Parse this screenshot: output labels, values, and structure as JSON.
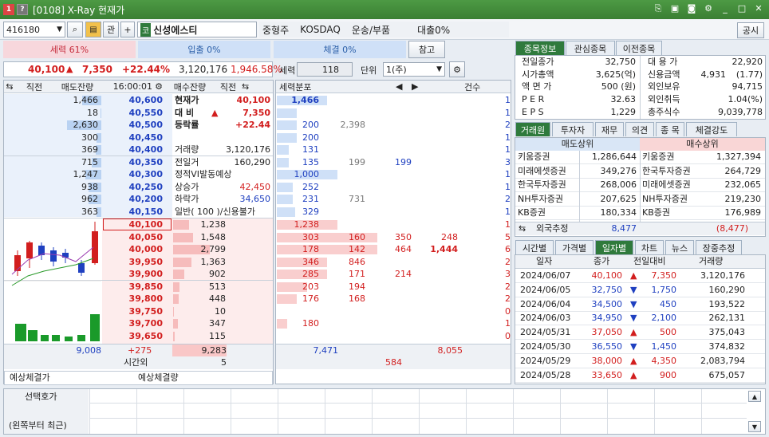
{
  "window": {
    "title": "[0108] X-Ray 현재가"
  },
  "toolbar": {
    "code": "416180",
    "gwan": "관",
    "market_badge": "코",
    "stock_name": "신성에스티",
    "size": "중형주",
    "market": "KOSDAQ",
    "sector": "운송/부품",
    "loan": "대출0%",
    "notice": "공시"
  },
  "indicators": {
    "force": "세력 61%",
    "inflow": "입출 0%",
    "contract": "체결 0%",
    "ref": "참고"
  },
  "quote": {
    "price": "40,100",
    "change": "7,350",
    "rate": "+22.44%",
    "volume": "3,120,176",
    "amount": "1,946.58%"
  },
  "controls": {
    "force_label": "세력",
    "force_val": "118",
    "unit_label": "단위",
    "unit_val": "1(주)"
  },
  "ob_header": {
    "c1": "직전",
    "c2": "매도잔량",
    "time": "16:00:01",
    "c3": "매수잔량",
    "c4": "직전",
    "dist": "세력분포",
    "cnt": "건수"
  },
  "asks": [
    {
      "qty": "1,466",
      "price": "40,600",
      "bar": 0.2,
      "d1": "1,466",
      "d2": "",
      "d3": "",
      "cnt": "1",
      "dbar": 0.5
    },
    {
      "qty": "18",
      "price": "40,550",
      "bar": 0.01,
      "d1": "",
      "d2": "",
      "d3": "",
      "cnt": "1",
      "dbar": 0.2
    },
    {
      "qty": "2,630",
      "price": "40,500",
      "bar": 0.36,
      "d1": "200",
      "d2": "2,398",
      "d3": "",
      "cnt": "2",
      "dbar": 0.2
    },
    {
      "qty": "300",
      "price": "40,450",
      "bar": 0.05,
      "d1": "200",
      "d2": "",
      "d3": "",
      "cnt": "1",
      "dbar": 0.2
    },
    {
      "qty": "369",
      "price": "40,400",
      "bar": 0.06,
      "d1": "131",
      "d2": "",
      "d3": "",
      "cnt": "1",
      "dbar": 0.12
    },
    {
      "qty": "715",
      "price": "40,350",
      "bar": 0.1,
      "d1": "135",
      "d2": "199",
      "d3": "199",
      "cnt": "3",
      "dbar": 0.12
    },
    {
      "qty": "1,247",
      "price": "40,300",
      "bar": 0.17,
      "d1": "1,000",
      "d2": "",
      "d3": "",
      "cnt": "1",
      "dbar": 0.6
    },
    {
      "qty": "938",
      "price": "40,250",
      "bar": 0.13,
      "d1": "252",
      "d2": "",
      "d3": "",
      "cnt": "1",
      "dbar": 0.16
    },
    {
      "qty": "962",
      "price": "40,200",
      "bar": 0.13,
      "d1": "231",
      "d2": "731",
      "d3": "",
      "cnt": "2",
      "dbar": 0.16
    },
    {
      "qty": "363",
      "price": "40,150",
      "bar": 0.05,
      "d1": "329",
      "d2": "",
      "d3": "",
      "cnt": "1",
      "dbar": 0.18
    }
  ],
  "bids": [
    {
      "price": "40,100",
      "qty": "1,238",
      "bar": 0.17,
      "d1": "1,238",
      "d2": "",
      "d3": "",
      "d4": "",
      "cnt": "1",
      "dbar": 0.6
    },
    {
      "price": "40,050",
      "qty": "1,548",
      "bar": 0.21,
      "d1": "303",
      "d2": "160",
      "d3": "350",
      "d4": "248",
      "cnt": "5",
      "dbar": 1.0
    },
    {
      "price": "40,000",
      "qty": "2,799",
      "bar": 0.38,
      "d1": "178",
      "d2": "142",
      "d3": "464",
      "d4": "1,444",
      "cnt": "6",
      "dbar": 1.0
    },
    {
      "price": "39,950",
      "qty": "1,363",
      "bar": 0.19,
      "d1": "346",
      "d2": "846",
      "d3": "",
      "d4": "",
      "cnt": "2",
      "dbar": 0.5
    },
    {
      "price": "39,900",
      "qty": "902",
      "bar": 0.12,
      "d1": "285",
      "d2": "171",
      "d3": "214",
      "d4": "",
      "cnt": "3",
      "dbar": 0.5
    },
    {
      "price": "39,850",
      "qty": "513",
      "bar": 0.07,
      "d1": "203",
      "d2": "194",
      "d3": "",
      "d4": "",
      "cnt": "2",
      "dbar": 0.3
    },
    {
      "price": "39,800",
      "qty": "448",
      "bar": 0.06,
      "d1": "176",
      "d2": "168",
      "d3": "",
      "d4": "",
      "cnt": "2",
      "dbar": 0.2
    },
    {
      "price": "39,750",
      "qty": "10",
      "bar": 0.01,
      "d1": "",
      "d2": "",
      "d3": "",
      "d4": "",
      "cnt": "0",
      "dbar": 0
    },
    {
      "price": "39,700",
      "qty": "347",
      "bar": 0.05,
      "d1": "180",
      "d2": "",
      "d3": "",
      "d4": "",
      "cnt": "1",
      "dbar": 0.1
    },
    {
      "price": "39,650",
      "qty": "115",
      "bar": 0.02,
      "d1": "",
      "d2": "",
      "d3": "",
      "d4": "",
      "cnt": "0",
      "dbar": 0
    }
  ],
  "info": [
    {
      "k": "현재가",
      "v": "40,100",
      "cls": "red bold"
    },
    {
      "k": "대 비",
      "v": "7,350",
      "cls": "red bold"
    },
    {
      "k": "등락률",
      "v": "+22.44",
      "cls": "red bold"
    },
    {
      "k": "",
      "v": "",
      "cls": ""
    },
    {
      "k": "거래량",
      "v": "3,120,176",
      "cls": ""
    },
    {
      "k": "전일거",
      "v": "160,290",
      "cls": ""
    },
    {
      "k": "정적VI발동예상",
      "v": "",
      "cls": ""
    },
    {
      "k": "상승가",
      "v": "42,450",
      "cls": "red"
    },
    {
      "k": "하락가",
      "v": "34,650",
      "cls": "blue"
    },
    {
      "k": "일반( 100 )/신용불가",
      "v": "",
      "cls": ""
    }
  ],
  "ob_footer": {
    "ask_total": "9,008",
    "diff": "+275",
    "bid_total": "9,283",
    "d_left": "7,471",
    "d_right": "8,055",
    "overtime_label": "시간외",
    "overtime_val": "5",
    "d_center": "584"
  },
  "expect": {
    "price_label": "예상체결가",
    "qty_label": "예상체결량"
  },
  "bottom": {
    "label1": "선택호가",
    "label2": "(왼쪽부터 최근)"
  },
  "right_tabs": [
    "종목정보",
    "관심종목",
    "이전종목"
  ],
  "summary_left": [
    {
      "k": "전일종가",
      "v": "32,750"
    },
    {
      "k": "시가총액",
      "v": "3,625(억)"
    },
    {
      "k": "액 면 가",
      "v": "500 (원)"
    },
    {
      "k": "P E R",
      "v": "32.63"
    },
    {
      "k": "E P S",
      "v": "1,229"
    }
  ],
  "summary_right": [
    {
      "k": "대 용 가",
      "v": "22,920",
      "v2": ""
    },
    {
      "k": "신용금액",
      "v": "(1.77)",
      "v2": "4,931"
    },
    {
      "k": "외인보유",
      "v": "94,715",
      "v2": ""
    },
    {
      "k": "외인취득",
      "v": "1.04(%)",
      "v2": ""
    },
    {
      "k": "총주식수",
      "v": "9,039,778",
      "v2": ""
    }
  ],
  "broker_tabs": [
    "거래원",
    "투자자",
    "재무",
    "의견",
    "종 목",
    "체결강도"
  ],
  "broker": {
    "sell_hdr": "매도상위",
    "buy_hdr": "매수상위",
    "foreign_label": "외국추정",
    "foreign_sell": "8,477",
    "foreign_buy": "(8,477)",
    "rows": [
      {
        "sn": "키움증권",
        "sq": "1,286,644",
        "bn": "키움증권",
        "bq": "1,327,394"
      },
      {
        "sn": "미래에셋증권",
        "sq": "349,276",
        "bn": "한국투자증권",
        "bq": "264,729"
      },
      {
        "sn": "한국투자증권",
        "sq": "268,006",
        "bn": "미래에셋증권",
        "bq": "232,065"
      },
      {
        "sn": "NH투자증권",
        "sq": "207,625",
        "bn": "NH투자증권",
        "bq": "219,230"
      },
      {
        "sn": "KB증권",
        "sq": "180,334",
        "bn": "KB증권",
        "bq": "176,989"
      }
    ]
  },
  "daily_tabs": [
    "시간별",
    "가격별",
    "일자별",
    "차트",
    "뉴스",
    "장중추정"
  ],
  "daily": {
    "headers": [
      "일자",
      "종가",
      "전일대비",
      "거래량"
    ],
    "rows": [
      {
        "date": "2024/06/07",
        "close": "40,100",
        "dir": "up",
        "chg": "7,350",
        "vol": "3,120,176"
      },
      {
        "date": "2024/06/05",
        "close": "32,750",
        "dir": "down",
        "chg": "1,750",
        "vol": "160,290"
      },
      {
        "date": "2024/06/04",
        "close": "34,500",
        "dir": "down",
        "chg": "450",
        "vol": "193,522"
      },
      {
        "date": "2024/06/03",
        "close": "34,950",
        "dir": "down",
        "chg": "2,100",
        "vol": "262,131"
      },
      {
        "date": "2024/05/31",
        "close": "37,050",
        "dir": "up",
        "chg": "500",
        "vol": "375,043"
      },
      {
        "date": "2024/05/30",
        "close": "36,550",
        "dir": "down",
        "chg": "1,450",
        "vol": "374,832"
      },
      {
        "date": "2024/05/29",
        "close": "38,000",
        "dir": "up",
        "chg": "4,350",
        "vol": "2,083,794"
      },
      {
        "date": "2024/05/28",
        "close": "33,650",
        "dir": "up",
        "chg": "900",
        "vol": "675,057"
      }
    ]
  },
  "colors": {
    "up": "#d21e1e",
    "down": "#1f40c0",
    "title_bar": "#3f8838"
  }
}
